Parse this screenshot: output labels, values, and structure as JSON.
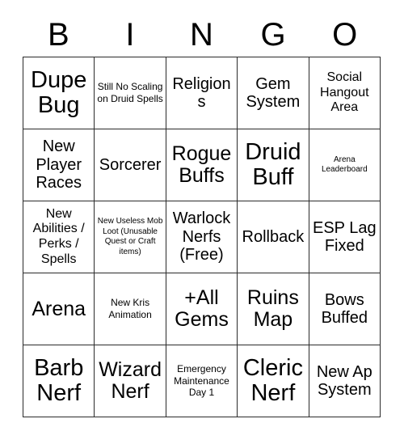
{
  "card": {
    "title_letters": [
      "B",
      "I",
      "N",
      "G",
      "O"
    ],
    "colors": {
      "background": "#ffffff",
      "text": "#000000",
      "border": "#2b2b2b"
    },
    "grid_size": "5x5",
    "columns": [
      {
        "letter": "B",
        "cells": [
          {
            "text": "Dupe Bug",
            "size": "xl"
          },
          {
            "text": "New Player Races",
            "size": "md"
          },
          {
            "text": "New Abilities / Perks / Spells",
            "size": "sm"
          },
          {
            "text": "Arena",
            "size": "lg"
          },
          {
            "text": "Barb Nerf",
            "size": "xl"
          }
        ]
      },
      {
        "letter": "I",
        "cells": [
          {
            "text": "Still No Scaling on Druid Spells",
            "size": "xs"
          },
          {
            "text": "Sorcerer",
            "size": "md"
          },
          {
            "text": "New Useless Mob Loot (Unusable Quest or Craft items)",
            "size": "xxs"
          },
          {
            "text": "New Kris Animation",
            "size": "xs"
          },
          {
            "text": "Wizard Nerf",
            "size": "lg"
          }
        ]
      },
      {
        "letter": "N",
        "cells": [
          {
            "text": "Religions",
            "size": "md"
          },
          {
            "text": "Rogue Buffs",
            "size": "lg"
          },
          {
            "text": "Warlock Nerfs (Free)",
            "size": "md"
          },
          {
            "text": "+All Gems",
            "size": "lg"
          },
          {
            "text": "Emergency Maintenance Day 1",
            "size": "xs"
          }
        ]
      },
      {
        "letter": "G",
        "cells": [
          {
            "text": "Gem System",
            "size": "md"
          },
          {
            "text": "Druid Buff",
            "size": "xl"
          },
          {
            "text": "Rollback",
            "size": "md"
          },
          {
            "text": "Ruins Map",
            "size": "lg"
          },
          {
            "text": "Cleric Nerf",
            "size": "xl"
          }
        ]
      },
      {
        "letter": "O",
        "cells": [
          {
            "text": "Social Hangout Area",
            "size": "sm"
          },
          {
            "text": "Arena Leaderboard",
            "size": "xxs"
          },
          {
            "text": "ESP Lag Fixed",
            "size": "md"
          },
          {
            "text": "Bows Buffed",
            "size": "md"
          },
          {
            "text": "New Ap System",
            "size": "md"
          }
        ]
      }
    ],
    "rows": [
      [
        "Dupe Bug",
        "Still No Scaling on Druid Spells",
        "Religions",
        "Gem System",
        "Social Hangout Area"
      ],
      [
        "New Player Races",
        "Sorcerer",
        "Rogue Buffs",
        "Druid Buff",
        "Arena Leaderboard"
      ],
      [
        "New Abilities / Perks / Spells",
        "New Useless Mob Loot (Unusable Quest or Craft items)",
        "Warlock Nerfs (Free)",
        "Rollback",
        "ESP Lag Fixed"
      ],
      [
        "Arena",
        "New Kris Animation",
        "+All Gems",
        "Ruins Map",
        "Bows Buffed"
      ],
      [
        "Barb Nerf",
        "Wizard Nerf",
        "Emergency Maintenance Day 1",
        "Cleric Nerf",
        "New Ap System"
      ]
    ]
  }
}
